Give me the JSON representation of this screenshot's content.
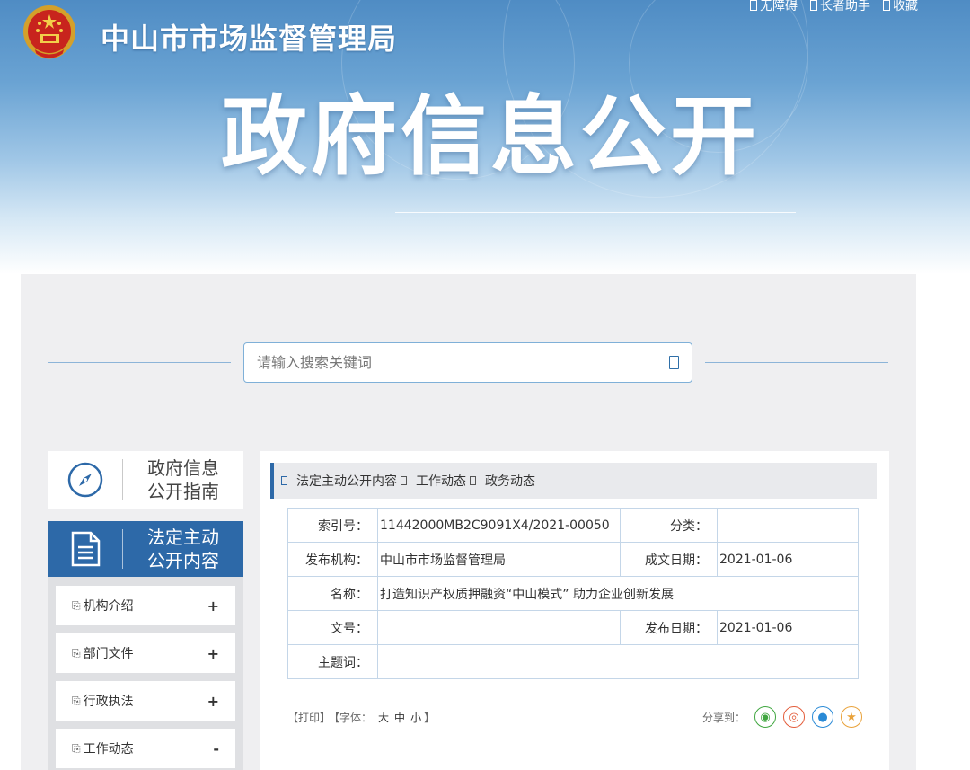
{
  "header": {
    "site_name": "中山市市场监督管理局",
    "page_heading": "政府信息公开",
    "top_links": [
      "无障碍",
      "长者助手",
      "收藏"
    ]
  },
  "search": {
    "placeholder": "请输入搜索关键词"
  },
  "sidebar": {
    "guide_label_1": "政府信息",
    "guide_label_2": "公开指南",
    "active_label_1": "法定主动",
    "active_label_2": "公开内容",
    "items": [
      {
        "label": "机构介绍",
        "toggle": "+"
      },
      {
        "label": "部门文件",
        "toggle": "+"
      },
      {
        "label": "行政执法",
        "toggle": "+"
      },
      {
        "label": "工作动态",
        "toggle": "-"
      }
    ]
  },
  "breadcrumb": [
    "法定主动公开内容",
    "工作动态",
    "政务动态"
  ],
  "meta": {
    "index_label": "索引号：",
    "index_value": "11442000MB2C9091X4/2021-00050",
    "category_label": "分类：",
    "category_value": "",
    "publisher_label": "发布机构：",
    "publisher_value": "中山市市场监督管理局",
    "created_label": "成文日期：",
    "created_value": "2021-01-06",
    "name_label": "名称：",
    "name_value": "打造知识产权质押融资“中山模式” 助力企业创新发展",
    "docno_label": "文号：",
    "docno_value": "",
    "published_label": "发布日期：",
    "published_value": "2021-01-06",
    "keywords_label": "主题词：",
    "keywords_value": ""
  },
  "tools": {
    "print": "【打印】",
    "font_prefix": "【字体：",
    "font_large": "大",
    "font_medium": "中",
    "font_small": "小",
    "font_suffix": "】",
    "share_label": "分享到："
  },
  "colors": {
    "primary": "#2d69a8",
    "panel_bg": "#efeff1",
    "banner_top": "#4f8cc4"
  }
}
